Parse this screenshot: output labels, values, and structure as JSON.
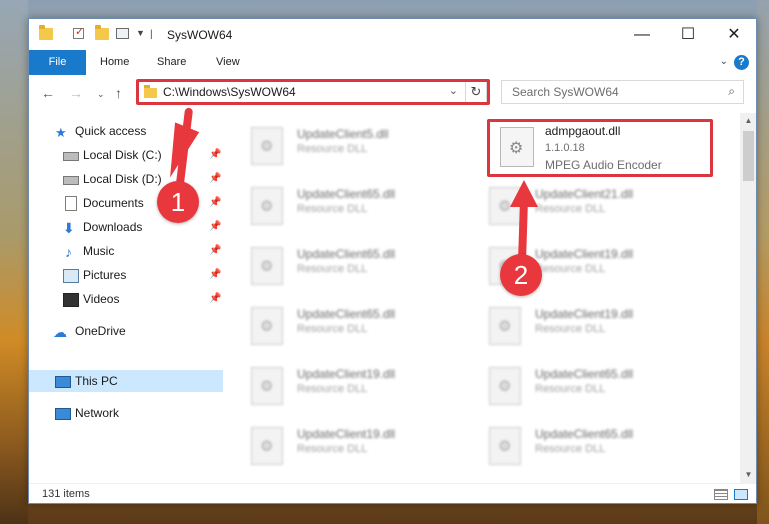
{
  "window": {
    "title": "SysWOW64"
  },
  "ribbon": {
    "tabs": [
      {
        "label": "File"
      },
      {
        "label": "Home"
      },
      {
        "label": "Share"
      },
      {
        "label": "View"
      }
    ],
    "help": "?"
  },
  "nav": {
    "address": "C:\\Windows\\SysWOW64",
    "search_placeholder": "Search SysWOW64"
  },
  "sidebar": {
    "items": [
      {
        "label": "Quick access"
      },
      {
        "label": "Local Disk (C:)"
      },
      {
        "label": "Local Disk (D:)"
      },
      {
        "label": "Documents"
      },
      {
        "label": "Downloads"
      },
      {
        "label": "Music"
      },
      {
        "label": "Pictures"
      },
      {
        "label": "Videos"
      },
      {
        "label": "OneDrive"
      },
      {
        "label": "This PC"
      },
      {
        "label": "Network"
      }
    ]
  },
  "files": [
    {
      "name": "UpdateClient5.dll",
      "desc": "Resource DLL"
    },
    {
      "name": "UpdateClient65.dll",
      "desc": "Resource DLL"
    },
    {
      "name": "UpdateClient65.dll",
      "desc": "Resource DLL"
    },
    {
      "name": "UpdateClient65.dll",
      "desc": "Resource DLL"
    },
    {
      "name": "UpdateClient19.dll",
      "desc": "Resource DLL"
    },
    {
      "name": "UpdateClient19.dll",
      "desc": "Resource DLL"
    },
    {
      "name": "UpdateClient21.dll",
      "desc": "Resource DLL"
    },
    {
      "name": "UpdateClient19.dll",
      "desc": "Resource DLL"
    },
    {
      "name": "UpdateClient19.dll",
      "desc": "Resource DLL"
    },
    {
      "name": "UpdateClient65.dll",
      "desc": "Resource DLL"
    },
    {
      "name": "UpdateClient65.dll",
      "desc": "Resource DLL"
    }
  ],
  "highlighted_file": {
    "name": "admpgaout.dll",
    "version": "1.1.0.18",
    "desc": "MPEG Audio Encoder"
  },
  "status": {
    "item_count": "131 items"
  },
  "annotations": {
    "step1": "1",
    "step2": "2",
    "color": "#e8383d"
  }
}
